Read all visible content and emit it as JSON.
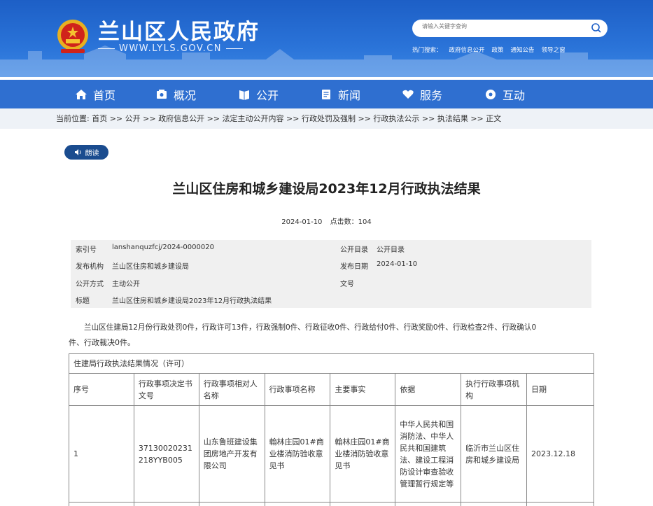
{
  "header": {
    "site_title": "兰山区人民政府",
    "site_url": "WWW.LYLS.GOV.CN",
    "search_placeholder": "请输入关键字查询",
    "hot_label": "热门搜索：",
    "hot_links": [
      "政府信息公开",
      "政策",
      "通知公告",
      "领导之窗"
    ]
  },
  "nav": {
    "items": [
      {
        "label": "首页",
        "icon": "home-icon"
      },
      {
        "label": "概况",
        "icon": "overview-icon"
      },
      {
        "label": "公开",
        "icon": "open-icon"
      },
      {
        "label": "新闻",
        "icon": "news-icon"
      },
      {
        "label": "服务",
        "icon": "service-icon"
      },
      {
        "label": "互动",
        "icon": "interact-icon"
      }
    ]
  },
  "breadcrumb": {
    "prefix": "当前位置:",
    "items": [
      "首页",
      "公开",
      "政府信息公开",
      "法定主动公开内容",
      "行政处罚及强制",
      "行政执法公示",
      "执法结果",
      "正文"
    ],
    "separator": " >> "
  },
  "read_button": "朗读",
  "article": {
    "title": "兰山区住房和城乡建设局2023年12月行政执法结果",
    "date": "2024-01-10",
    "views_label": "点击数：",
    "views": "104"
  },
  "info": {
    "index_label": "索引号",
    "index_value": "lanshanquzfcj/2024-0000020",
    "catalog_label": "公开目录",
    "catalog_value": "公开目录",
    "org_label": "发布机构",
    "org_value": "兰山区住房和城乡建设局",
    "pubdate_label": "发布日期",
    "pubdate_value": "2024-01-10",
    "method_label": "公开方式",
    "method_value": "主动公开",
    "docno_label": "文号",
    "docno_value": "",
    "subject_label": "标题",
    "subject_value": "兰山区住房和城乡建设局2023年12月行政执法结果"
  },
  "paragraph": {
    "line1": "兰山区住建局12月份行政处罚0件，行政许可13件，行政强制0件、行政征收0件、行政给付0件、行政奖励0件、行政检查2件、行政确认0",
    "line2": "件、行政裁决0件。"
  },
  "result_table": {
    "caption": "住建局行政执法结果情况（许可）",
    "headers": [
      "序号",
      "行政事项决定书文号",
      "行政事项相对人名称",
      "行政事项名称",
      "主要事实",
      "依据",
      "执行行政事项机构",
      "日期"
    ],
    "rows": [
      [
        "1",
        "37130020231218YYB005",
        "山东鲁班建设集团房地产开发有限公司",
        "翰林庄园01#商业楼消防验收意见书",
        "翰林庄园01#商业楼消防验收意见书",
        "中华人民共和国消防法、中华人民共和国建筑法、建设工程消防设计审查验收管理暂行规定等",
        "临沂市兰山区住房和城乡建设局",
        "2023.12.18"
      ]
    ]
  }
}
